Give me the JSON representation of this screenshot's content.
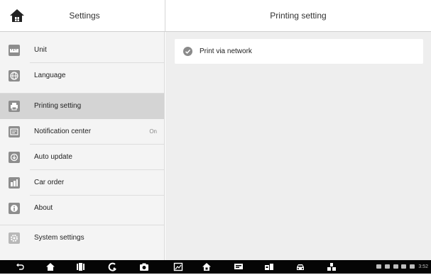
{
  "header": {
    "left_title": "Settings",
    "right_title": "Printing setting"
  },
  "sidebar": {
    "items": [
      {
        "label": "Unit",
        "icon": "ruler-icon"
      },
      {
        "label": "Language",
        "icon": "globe-icon"
      },
      {
        "label": "Printing setting",
        "icon": "printer-icon",
        "active": true
      },
      {
        "label": "Notification center",
        "value": "On",
        "icon": "notification-icon"
      },
      {
        "label": "Auto update",
        "icon": "update-icon"
      },
      {
        "label": "Car order",
        "icon": "car-order-icon"
      },
      {
        "label": "About",
        "icon": "info-icon"
      },
      {
        "label": "System settings",
        "icon": "gear-icon"
      }
    ]
  },
  "content": {
    "option_label": "Print via network",
    "option_checked": true
  },
  "navbar": {
    "buttons": [
      "back-icon",
      "home-icon",
      "recent-apps-icon",
      "browser-icon",
      "camera-icon",
      "screenshot-icon",
      "home-app-icon",
      "vci-icon",
      "vehicle-icon",
      "car-icon",
      "shortcut-icon"
    ],
    "status_text": "3:52"
  },
  "colors": {
    "active_bg": "#d4d4d4",
    "sidebar_bg": "#f4f4f4",
    "content_bg": "#eeeeee",
    "navbar_bg": "#050505"
  }
}
